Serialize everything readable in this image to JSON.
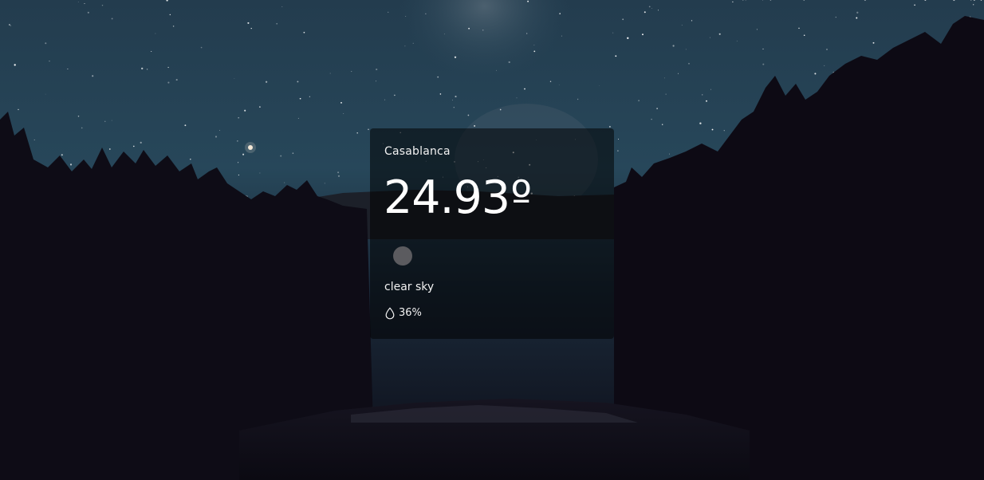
{
  "weather": {
    "city": "Casablanca",
    "temperature": "24.93",
    "degree_symbol": "º",
    "description": "clear sky",
    "humidity": "36%"
  },
  "icons": {
    "weather": "weather-icon",
    "humidity": "water-drop-icon"
  },
  "colors": {
    "card_background": "#000000",
    "text": "#ffffff",
    "sky_top": "#1f3a4d",
    "sky_bottom": "#26404f",
    "forest": "#0e0a14"
  }
}
